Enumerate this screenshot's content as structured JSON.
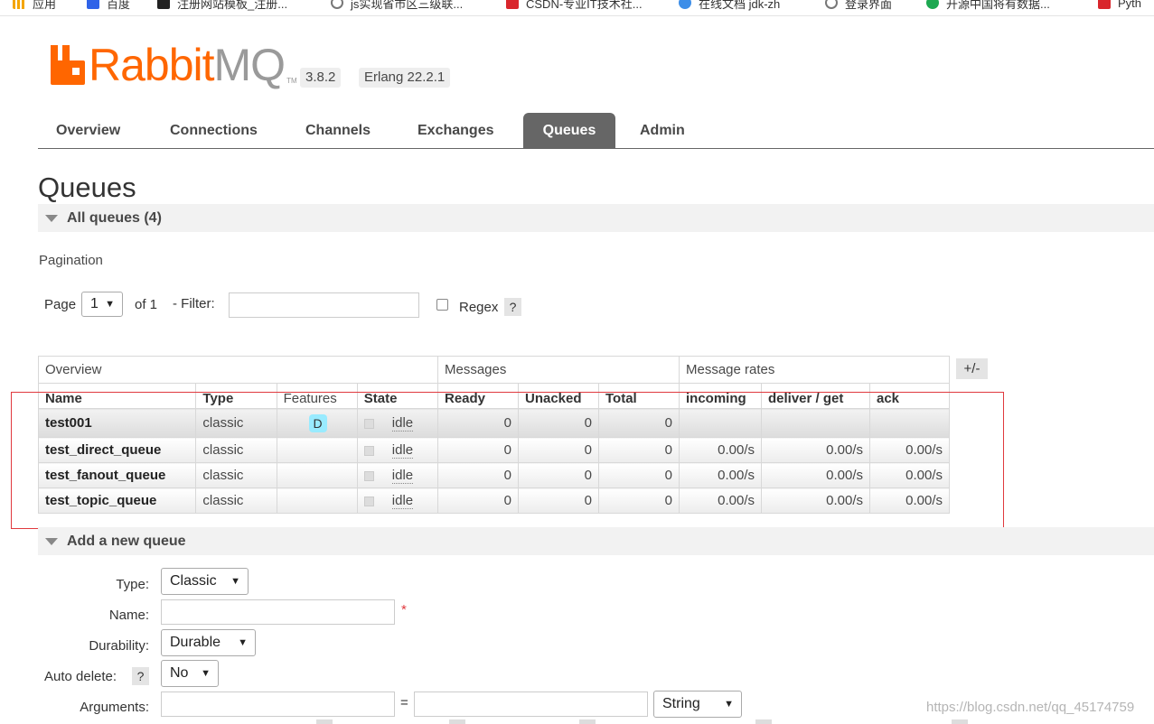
{
  "bookmarks": [
    {
      "label": "应用",
      "icon": "apps-grid-icon"
    },
    {
      "label": "百度",
      "icon": "baidu-icon"
    },
    {
      "label": "注册网站模板_注册...",
      "icon": "site-icon"
    },
    {
      "label": "js实现省市区三级联...",
      "icon": "globe-icon"
    },
    {
      "label": "CSDN-专业IT技术社...",
      "icon": "csdn-icon"
    },
    {
      "label": "在线文档 jdk-zh",
      "icon": "doc-icon"
    },
    {
      "label": "登录界面",
      "icon": "globe-icon"
    },
    {
      "label": "开源中国将有数据...",
      "icon": "oschina-icon"
    },
    {
      "label": "Pyth",
      "icon": "csdn-icon"
    }
  ],
  "header": {
    "logo_rabbit": "Rabbit",
    "logo_mq": "MQ",
    "logo_tm": "TM",
    "version": "3.8.2",
    "erlang": "Erlang 22.2.1"
  },
  "nav": {
    "tabs": [
      "Overview",
      "Connections",
      "Channels",
      "Exchanges",
      "Queues",
      "Admin"
    ],
    "active": "Queues"
  },
  "page_title": "Queues",
  "all_queues": "All queues (4)",
  "pagination": {
    "label": "Pagination",
    "page_label": "Page",
    "page_value": "1",
    "of_label": "of 1",
    "filter_label": "- Filter:",
    "filter_value": "",
    "regex_label": "Regex",
    "help": "?"
  },
  "table": {
    "group_headers": [
      "Overview",
      "Messages",
      "Message rates"
    ],
    "plus_minus": "+/-",
    "columns": [
      "Name",
      "Type",
      "Features",
      "State",
      "Ready",
      "Unacked",
      "Total",
      "incoming",
      "deliver / get",
      "ack"
    ],
    "rows": [
      {
        "name": "test001",
        "type": "classic",
        "features": "D",
        "state": "idle",
        "ready": "0",
        "unacked": "0",
        "total": "0",
        "incoming": "",
        "deliver_get": "",
        "ack": ""
      },
      {
        "name": "test_direct_queue",
        "type": "classic",
        "features": "",
        "state": "idle",
        "ready": "0",
        "unacked": "0",
        "total": "0",
        "incoming": "0.00/s",
        "deliver_get": "0.00/s",
        "ack": "0.00/s"
      },
      {
        "name": "test_fanout_queue",
        "type": "classic",
        "features": "",
        "state": "idle",
        "ready": "0",
        "unacked": "0",
        "total": "0",
        "incoming": "0.00/s",
        "deliver_get": "0.00/s",
        "ack": "0.00/s"
      },
      {
        "name": "test_topic_queue",
        "type": "classic",
        "features": "",
        "state": "idle",
        "ready": "0",
        "unacked": "0",
        "total": "0",
        "incoming": "0.00/s",
        "deliver_get": "0.00/s",
        "ack": "0.00/s"
      }
    ]
  },
  "add_queue": {
    "title": "Add a new queue",
    "type_label": "Type:",
    "type_value": "Classic",
    "name_label": "Name:",
    "name_value": "",
    "required_mark": "*",
    "durability_label": "Durability:",
    "durability_value": "Durable",
    "auto_delete_label": "Auto delete:",
    "auto_delete_help": "?",
    "auto_delete_value": "No",
    "arguments_label": "Arguments:",
    "arguments_eq": "=",
    "arguments_type": "String"
  },
  "watermark": "https://blog.csdn.net/qq_45174759"
}
